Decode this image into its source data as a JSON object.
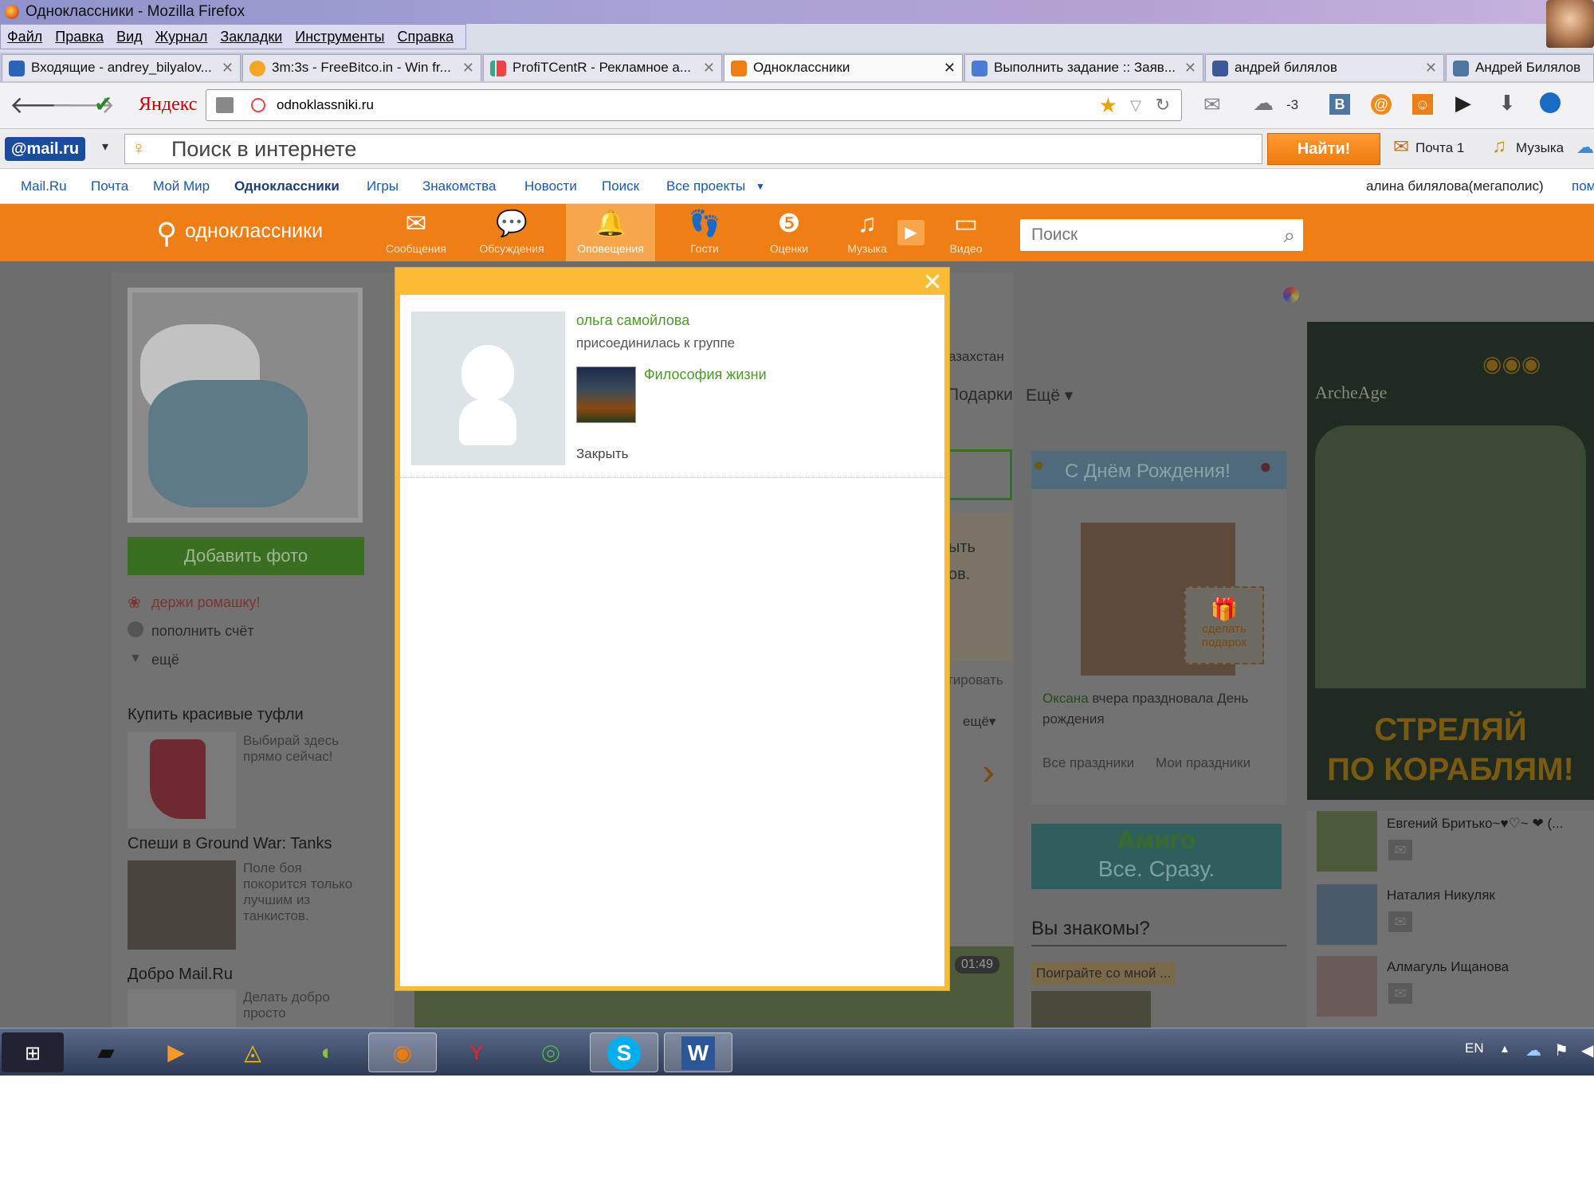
{
  "window": {
    "title": "Одноклассники - Mozilla Firefox"
  },
  "menu": [
    "Файл",
    "Правка",
    "Вид",
    "Журнал",
    "Закладки",
    "Инструменты",
    "Справка"
  ],
  "tabs": [
    {
      "label": "Входящие - andrey_bilyalov..."
    },
    {
      "label": "3m:3s - FreeBitco.in - Win fr..."
    },
    {
      "label": "ProfiTCentR - Рекламное а..."
    },
    {
      "label": "Одноклассники"
    },
    {
      "label": "Выполнить задание :: Заяв..."
    },
    {
      "label": "андрей билялов"
    },
    {
      "label": "Андрей Билялов"
    }
  ],
  "toolbar": {
    "brand": "Яндекс",
    "url": "odnoklassniki.ru",
    "weather": "-3"
  },
  "mailru": {
    "logo": "@mail.ru",
    "search_placeholder": "Поиск в интернете",
    "find_button": "Найти!",
    "mail_link": "Почта 1",
    "music_link": "Музыка"
  },
  "projects": {
    "links": [
      "Mail.Ru",
      "Почта",
      "Мой Мир",
      "Одноклассники",
      "Игры",
      "Знакомства",
      "Новости",
      "Поиск",
      "Все проекты"
    ],
    "user": "алина билялова(мегаполис)",
    "help": "пом"
  },
  "ok": {
    "logo": "одноклассники",
    "nav": [
      "Сообщения",
      "Обсуждения",
      "Оповещения",
      "Гости",
      "Оценки",
      "Музыка",
      "Видео"
    ],
    "search_placeholder": "Поиск"
  },
  "left": {
    "add_photo": "Добавить фото",
    "links": [
      "держи ромашку!",
      "пополнить счёт",
      "ещё"
    ],
    "ads": [
      {
        "title": "Купить красивые туфли",
        "text": "Выбирай здесь прямо сейчас!"
      },
      {
        "title": "Спеши в Ground War: Tanks",
        "text": "Поле боя покорится только лучшим из танкистов."
      },
      {
        "title": "Добро Mail.Ru",
        "text": "Делать добро просто"
      }
    ]
  },
  "middle": {
    "country": "азахстан",
    "menu_gifts": "Подарки",
    "menu_more": "Ещё ▾",
    "text1": "ыть",
    "text2": "ов.",
    "comment": "тировать",
    "more": "ещё▾",
    "time": "01:49"
  },
  "birthday": {
    "title": "С Днём Рождения!",
    "gift": "сделать подарок",
    "name": "Оксана",
    "text": " вчера праздновала День рождения",
    "all": "Все праздники",
    "mine": "Мои праздники"
  },
  "amigo": {
    "line1": "Амиго",
    "line2": "Все. Сразу."
  },
  "know": {
    "title": "Вы знакомы?",
    "play": "Поиграйте со мной ..."
  },
  "ad_right": {
    "brand": "ArcheAge",
    "text1": "СТРЕЛЯЙ",
    "text2": "ПО КОРАБЛЯМ!"
  },
  "friends": [
    "Евгений Бритько~♥♡~ ❤ (...",
    "Наталия Никуляк",
    "Алмагуль Ищанова"
  ],
  "notification": {
    "name": "ольга самойлова",
    "action": "присоединилась к группе",
    "group": "Философия жизни",
    "close": "Закрыть"
  },
  "taskbar": {
    "lang": "EN"
  },
  "colors": {
    "ok_orange": "#ef7f15",
    "modal_border": "#fbbc33",
    "link_green": "#4b9b26",
    "link_blue": "#1a5aa6"
  }
}
